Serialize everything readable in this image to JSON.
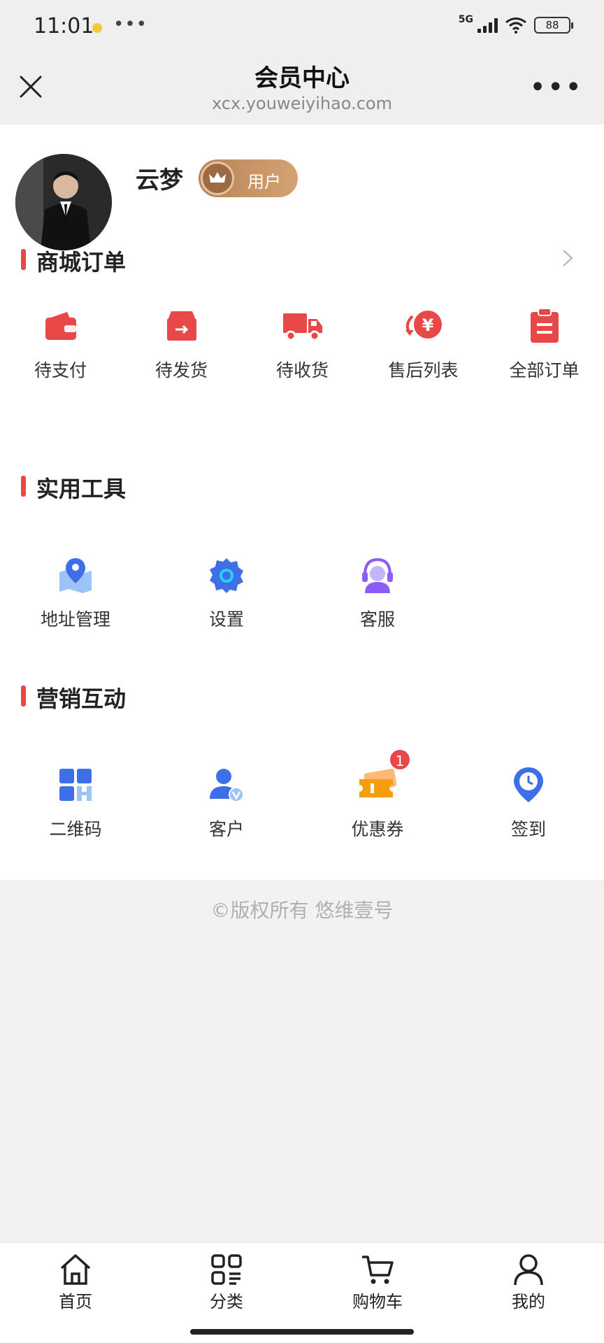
{
  "status_bar": {
    "time": "11:01",
    "network": "5G",
    "battery": "88"
  },
  "nav": {
    "title": "会员中心",
    "subtitle": "xcx.youweiyihao.com"
  },
  "profile": {
    "name": "云梦",
    "badge": "用户"
  },
  "orders": {
    "title": "商城订单",
    "items": [
      {
        "label": "待支付",
        "icon": "wallet-icon"
      },
      {
        "label": "待发货",
        "icon": "ship-box-icon"
      },
      {
        "label": "待收货",
        "icon": "truck-icon"
      },
      {
        "label": "售后列表",
        "icon": "refund-icon"
      },
      {
        "label": "全部订单",
        "icon": "clipboard-icon"
      }
    ]
  },
  "tools": {
    "title": "实用工具",
    "items": [
      {
        "label": "地址管理",
        "icon": "map-pin-icon"
      },
      {
        "label": "设置",
        "icon": "gear-icon"
      },
      {
        "label": "客服",
        "icon": "headset-icon"
      }
    ]
  },
  "marketing": {
    "title": "营销互动",
    "items": [
      {
        "label": "二维码",
        "icon": "qrcode-icon"
      },
      {
        "label": "客户",
        "icon": "customer-icon"
      },
      {
        "label": "优惠券",
        "icon": "coupon-icon",
        "badge": "1"
      },
      {
        "label": "签到",
        "icon": "checkin-icon"
      }
    ]
  },
  "copyright": "©版权所有 悠维壹号",
  "tabbar": [
    {
      "label": "首页",
      "icon": "home-icon"
    },
    {
      "label": "分类",
      "icon": "category-icon"
    },
    {
      "label": "购物车",
      "icon": "cart-icon"
    },
    {
      "label": "我的",
      "icon": "user-icon"
    }
  ],
  "colors": {
    "accent": "#e84848",
    "blue": "#3f6fe8",
    "gold": "#c99566",
    "purple": "#8b5cf6",
    "orange": "#f59e0b"
  }
}
